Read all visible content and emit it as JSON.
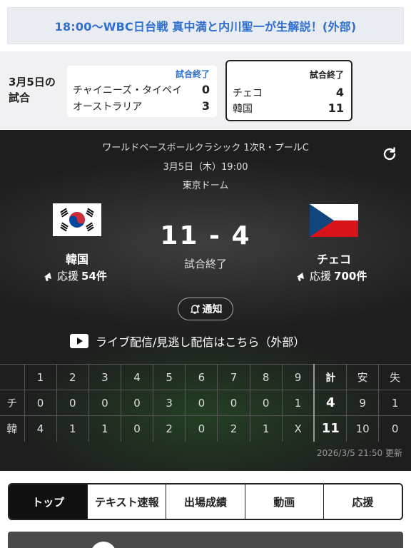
{
  "banner": {
    "text": "18:00〜WBC日台戦 真中満と内川聖一が生解説！(外部)"
  },
  "games": {
    "date_label": "3月5日の試合",
    "cards": [
      {
        "status": "試合終了",
        "team1": "チャイニーズ・タイペイ",
        "score1": "0",
        "team2": "オーストラリア",
        "score2": "3"
      },
      {
        "status": "試合終了",
        "team1": "チェコ",
        "score1": "4",
        "team2": "韓国",
        "score2": "11"
      }
    ]
  },
  "game": {
    "title": "ワールドベースボールクラシック 1次R・プールC",
    "datetime": "3月5日（木）19:00",
    "venue": "東京ドーム",
    "score": "11 - 4",
    "state": "試合終了",
    "home": {
      "name": "韓国",
      "support_label": "応援",
      "support_count": "54件"
    },
    "away": {
      "name": "チェコ",
      "support_label": "応援",
      "support_count": "700件"
    },
    "notify_label": "通知",
    "live_text": "ライブ配信/見逃し配信はこちら（外部）",
    "updated": "2026/3/5 21:50 更新"
  },
  "linescore": {
    "headers": [
      "",
      "1",
      "2",
      "3",
      "4",
      "5",
      "6",
      "7",
      "8",
      "9",
      "計",
      "安",
      "失"
    ],
    "rows": [
      [
        "チ",
        "0",
        "0",
        "0",
        "0",
        "3",
        "0",
        "0",
        "0",
        "1",
        "4",
        "9",
        "1"
      ],
      [
        "韓",
        "4",
        "1",
        "1",
        "0",
        "2",
        "0",
        "2",
        "1",
        "X",
        "11",
        "10",
        "0"
      ]
    ]
  },
  "tabs": [
    "トップ",
    "テキスト速報",
    "出場成績",
    "動画",
    "応援"
  ],
  "colors": {
    "accent_blue": "#2f6fd0",
    "korea_red": "#cd2e3a",
    "korea_blue": "#0047a0",
    "czech_blue": "#11457e",
    "czech_red": "#d7141a"
  }
}
